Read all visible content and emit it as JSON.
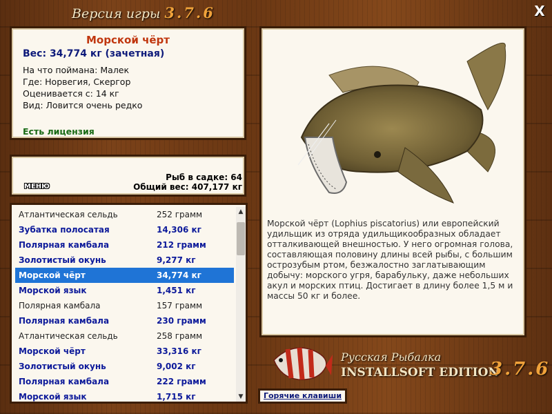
{
  "window": {
    "title": "Версия игры",
    "version": "3.7.6",
    "close_label": "X"
  },
  "info": {
    "name": "Морской чёрт",
    "weight": "Вес: 34,774 кг (зачетная)",
    "lines": [
      "На что поймана: Малек",
      "Где: Норвегия, Скергор",
      "Оценивается с: 14 кг",
      "Вид: Ловится очень редко"
    ],
    "license": "Есть лицензия"
  },
  "stats": {
    "menu_label": "МЕНЮ",
    "count": "Рыб в садке: 64",
    "total": "Общий вес: 407,177 кг"
  },
  "catch_list": {
    "selected_index": 4,
    "rows": [
      {
        "name": "Атлантическая сельдь",
        "weight": "252 грамм",
        "style": "plain"
      },
      {
        "name": "Зубатка полосатая",
        "weight": "14,306 кг",
        "style": "bold"
      },
      {
        "name": "Полярная камбала",
        "weight": "212 грамм",
        "style": "bold"
      },
      {
        "name": "Золотистый окунь",
        "weight": "9,277 кг",
        "style": "bold"
      },
      {
        "name": "Морской чёрт",
        "weight": "34,774 кг",
        "style": "sel"
      },
      {
        "name": "Морской язык",
        "weight": "1,451 кг",
        "style": "bold"
      },
      {
        "name": "Полярная камбала",
        "weight": "157 грамм",
        "style": "plain"
      },
      {
        "name": "Полярная камбала",
        "weight": "230 грамм",
        "style": "bold"
      },
      {
        "name": "Атлантическая сельдь",
        "weight": "258 грамм",
        "style": "plain"
      },
      {
        "name": "Морской чёрт",
        "weight": "33,316 кг",
        "style": "bold"
      },
      {
        "name": "Золотистый окунь",
        "weight": "9,002 кг",
        "style": "bold"
      },
      {
        "name": "Полярная камбала",
        "weight": "222 грамм",
        "style": "bold"
      },
      {
        "name": "Морской язык",
        "weight": "1,715 кг",
        "style": "bold"
      }
    ]
  },
  "description": "Морской чёрт (Lophius piscatorius) или европейский удильщик из отряда удильщикообразных обладает отталкивающей внешностью. У него огромная голова, составляющая половину длины всей рыбы, с большим острозубым ртом, безжалостно заглатывающим добычу: морского угря, барабульку, даже небольших акул и морских птиц. Достигает в длину более 1,5 м и массы 50 кг и более.",
  "branding": {
    "line1": "Русская Рыбалка",
    "line2": "INSTALLSOFT EDITION",
    "version": "3.7.6"
  },
  "hotkeys_label": "Горячие клавиши",
  "colors": {
    "accent_orange": "#f0a23a",
    "name_red": "#c0360e",
    "weight_blue": "#0d1a7a",
    "license_green": "#186a14",
    "selection_blue": "#1f74d6"
  }
}
